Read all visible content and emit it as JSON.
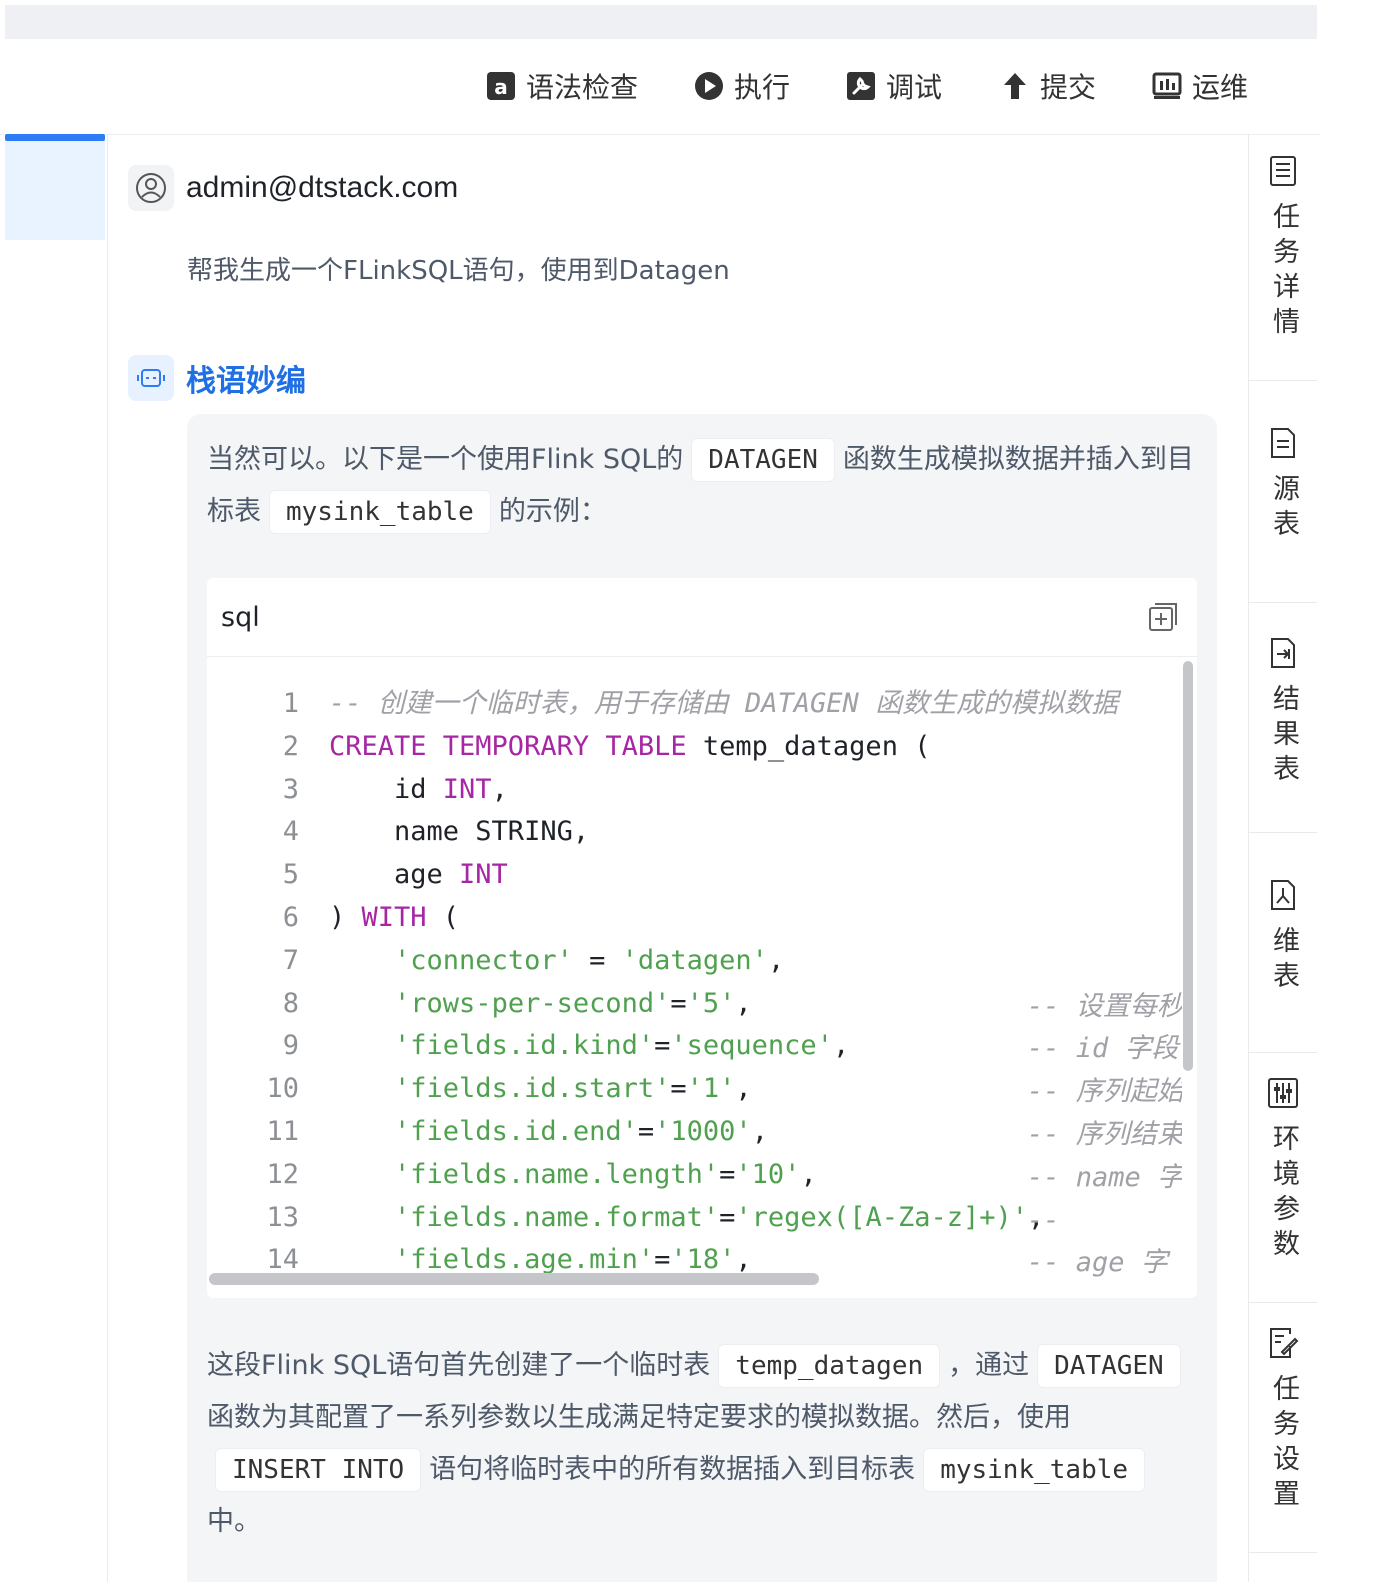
{
  "toolbar": {
    "items": [
      {
        "label": "语法检查",
        "icon": "syntax-check-icon"
      },
      {
        "label": "执行",
        "icon": "play-icon"
      },
      {
        "label": "调试",
        "icon": "debug-icon"
      },
      {
        "label": "提交",
        "icon": "upload-arrow-icon"
      },
      {
        "label": "运维",
        "icon": "ops-monitor-icon"
      }
    ]
  },
  "right_panel": {
    "items": [
      {
        "label": "任务详情",
        "icon": "task-detail-icon"
      },
      {
        "label": "源表",
        "icon": "source-table-icon"
      },
      {
        "label": "结果表",
        "icon": "result-table-icon"
      },
      {
        "label": "维表",
        "icon": "dimension-table-icon"
      },
      {
        "label": "环境参数",
        "icon": "env-params-icon"
      },
      {
        "label": "任务设置",
        "icon": "task-settings-icon"
      }
    ]
  },
  "chat": {
    "user": {
      "name": "admin@dtstack.com",
      "message": "帮我生成一个FLinkSQL语句，使用到Datagen"
    },
    "bot": {
      "name": "栈语妙编",
      "intro": {
        "t1": "当然可以。以下是一个使用Flink SQL的",
        "c1": "DATAGEN",
        "t2": "函数生成模拟数据并插入到目标表",
        "c2": "mysink_table",
        "t3": "的示例："
      },
      "code": {
        "language": "sql",
        "lines": [
          {
            "n": "1",
            "parts": [
              {
                "t": "-- 创建一个临时表，用于存储由 DATAGEN 函数生成的模拟数据",
                "c": "cm"
              }
            ]
          },
          {
            "n": "2",
            "parts": [
              {
                "t": "CREATE TEMPORARY TABLE",
                "c": "kw"
              },
              {
                "t": " temp_datagen (",
                "c": "ct"
              }
            ]
          },
          {
            "n": "3",
            "parts": [
              {
                "t": "    id ",
                "c": "ct"
              },
              {
                "t": "INT",
                "c": "kw"
              },
              {
                "t": ",",
                "c": "ct"
              }
            ]
          },
          {
            "n": "4",
            "parts": [
              {
                "t": "    name STRING,",
                "c": "ct"
              }
            ]
          },
          {
            "n": "5",
            "parts": [
              {
                "t": "    age ",
                "c": "ct"
              },
              {
                "t": "INT",
                "c": "kw"
              }
            ]
          },
          {
            "n": "6",
            "parts": [
              {
                "t": ") ",
                "c": "ct"
              },
              {
                "t": "WITH",
                "c": "kw"
              },
              {
                "t": " (",
                "c": "ct"
              }
            ]
          },
          {
            "n": "7",
            "parts": [
              {
                "t": "    ",
                "c": "ct"
              },
              {
                "t": "'connector'",
                "c": "str"
              },
              {
                "t": " = ",
                "c": "ct"
              },
              {
                "t": "'datagen'",
                "c": "str"
              },
              {
                "t": ",",
                "c": "ct"
              }
            ]
          },
          {
            "n": "8",
            "parts": [
              {
                "t": "    ",
                "c": "ct"
              },
              {
                "t": "'rows-per-second'",
                "c": "str"
              },
              {
                "t": "=",
                "c": "ct"
              },
              {
                "t": "'5'",
                "c": "str"
              },
              {
                "t": ",",
                "c": "ct"
              }
            ],
            "tail": "-- 设置每秒"
          },
          {
            "n": "9",
            "parts": [
              {
                "t": "    ",
                "c": "ct"
              },
              {
                "t": "'fields.id.kind'",
                "c": "str"
              },
              {
                "t": "=",
                "c": "ct"
              },
              {
                "t": "'sequence'",
                "c": "str"
              },
              {
                "t": ",",
                "c": "ct"
              }
            ],
            "tail": "-- id 字段"
          },
          {
            "n": "10",
            "parts": [
              {
                "t": "    ",
                "c": "ct"
              },
              {
                "t": "'fields.id.start'",
                "c": "str"
              },
              {
                "t": "=",
                "c": "ct"
              },
              {
                "t": "'1'",
                "c": "str"
              },
              {
                "t": ",",
                "c": "ct"
              }
            ],
            "tail": "-- 序列起始"
          },
          {
            "n": "11",
            "parts": [
              {
                "t": "    ",
                "c": "ct"
              },
              {
                "t": "'fields.id.end'",
                "c": "str"
              },
              {
                "t": "=",
                "c": "ct"
              },
              {
                "t": "'1000'",
                "c": "str"
              },
              {
                "t": ",",
                "c": "ct"
              }
            ],
            "tail": "-- 序列结束"
          },
          {
            "n": "12",
            "parts": [
              {
                "t": "    ",
                "c": "ct"
              },
              {
                "t": "'fields.name.length'",
                "c": "str"
              },
              {
                "t": "=",
                "c": "ct"
              },
              {
                "t": "'10'",
                "c": "str"
              },
              {
                "t": ",",
                "c": "ct"
              }
            ],
            "tail": "-- name 字"
          },
          {
            "n": "13",
            "parts": [
              {
                "t": "    ",
                "c": "ct"
              },
              {
                "t": "'fields.name.format'",
                "c": "str"
              },
              {
                "t": "=",
                "c": "ct"
              },
              {
                "t": "'regex([A-Za-z]+)'",
                "c": "str"
              },
              {
                "t": ",",
                "c": "ct"
              }
            ],
            "tail": "    --"
          },
          {
            "n": "14",
            "parts": [
              {
                "t": "    ",
                "c": "ct"
              },
              {
                "t": "'fields.age.min'",
                "c": "str"
              },
              {
                "t": "=",
                "c": "ct"
              },
              {
                "t": "'18'",
                "c": "str"
              },
              {
                "t": ",",
                "c": "ct"
              }
            ],
            "tail": " -- age 字"
          }
        ]
      },
      "explanation": {
        "t1": "这段Flink SQL语句首先创建了一个临时表",
        "c1": "temp_datagen",
        "t2": "，通过",
        "c2": "DATAGEN",
        "t3": "函数为其配置了一系列参数以生成满足特定要求的模拟数据。然后，使用",
        "c3": "INSERT INTO",
        "t4": "语句将临时表中的所有数据插入到目标表",
        "c4": "mysink_table",
        "t5": "中。"
      }
    }
  },
  "colors": {
    "accent": "#1f6fe5",
    "keyword": "#a626a4",
    "string": "#50a14f",
    "comment": "#a0a1a7"
  }
}
